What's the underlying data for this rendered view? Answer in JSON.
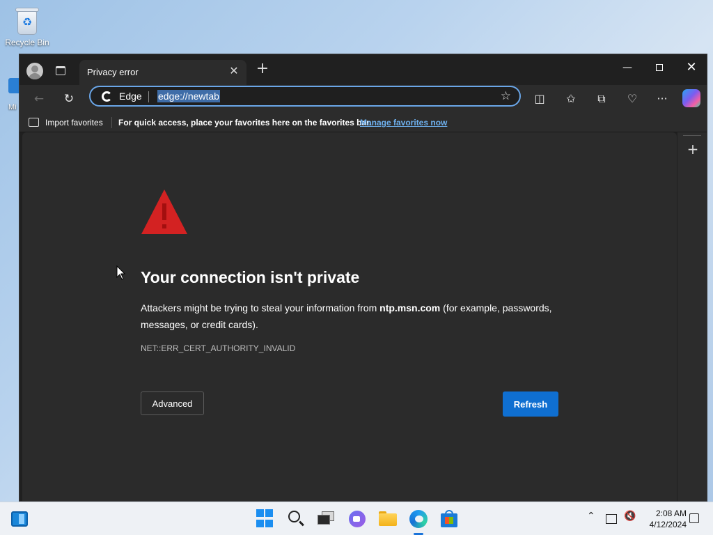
{
  "desktop": {
    "recycle_bin_label": "Recycle Bin",
    "partial_icon_label": "Mi"
  },
  "browser": {
    "tab": {
      "title": "Privacy error"
    },
    "address_bar": {
      "browser_label": "Edge",
      "url": "edge://newtab"
    },
    "favorites_bar": {
      "import_label": "Import favorites",
      "message": "For quick access, place your favorites here on the favorites bar.",
      "manage_link": "Manage favorites now"
    },
    "error_page": {
      "title": "Your connection isn't private",
      "desc_prefix": "Attackers might be trying to steal your information from",
      "host": "ntp.msn.com",
      "desc_suffix": "(for example, passwords, messages, or credit cards).",
      "error_code": "NET::ERR_CERT_AUTHORITY_INVALID",
      "advanced_label": "Advanced",
      "refresh_label": "Refresh"
    }
  },
  "taskbar": {
    "time": "2:08 AM",
    "date": "4/12/2024"
  },
  "colors": {
    "accent": "#0f6fd1",
    "warning": "#d32222",
    "link": "#6eb0ee",
    "page_bg": "#2b2b2b"
  },
  "icons": [
    "recycle-bin-icon",
    "profile-icon",
    "tab-actions-icon",
    "close-icon",
    "plus-icon",
    "minimize-icon",
    "maximize-icon",
    "back-icon",
    "refresh-icon",
    "edge-icon",
    "star-icon",
    "split-screen-icon",
    "favorites-icon",
    "collections-icon",
    "browser-essentials-icon",
    "more-icon",
    "copilot-icon",
    "import-icon",
    "warning-icon",
    "widgets-icon",
    "start-icon",
    "search-icon",
    "task-view-icon",
    "teams-icon",
    "file-explorer-icon",
    "store-icon",
    "chevron-up-icon",
    "network-icon",
    "volume-icon",
    "notification-icon"
  ]
}
